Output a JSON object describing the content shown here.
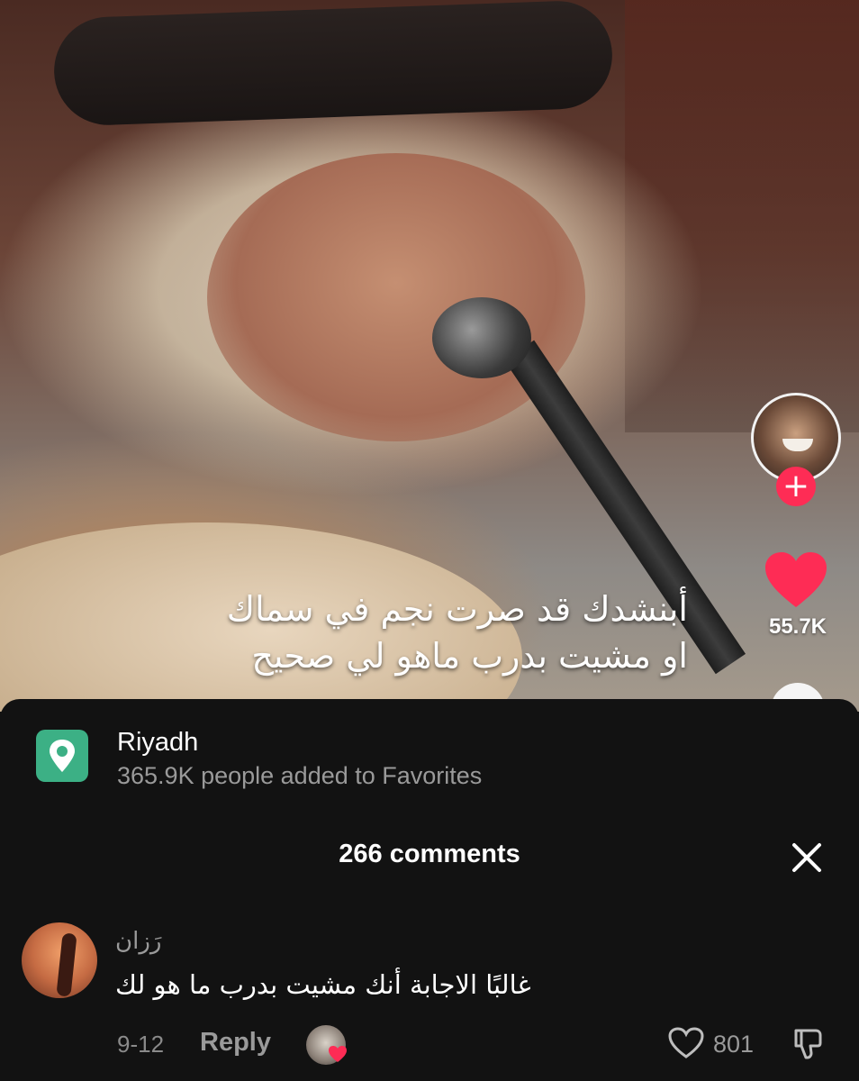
{
  "video": {
    "caption_line1": "أبنشدك قد صرت نجم في سماك",
    "caption_line2": "او مشيت بدرب ماهو لي صحيح",
    "like_count": "55.7K",
    "follow_symbol": "+"
  },
  "location": {
    "title": "Riyadh",
    "subtitle": "365.9K people added to Favorites",
    "icon": "map-pin-icon",
    "color": "#3cb085"
  },
  "comments": {
    "title": "266 comments",
    "close_icon": "close-icon",
    "items": [
      {
        "username": "رَزان",
        "text": "غالبًا الاجابة أنك مشيت بدرب ما هو لك",
        "date": "9-12",
        "reply_label": "Reply",
        "like_count": "801"
      }
    ]
  },
  "colors": {
    "accent_red": "#fe2c55",
    "background": "#121212"
  }
}
